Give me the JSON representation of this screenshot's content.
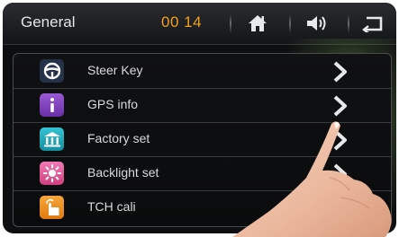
{
  "header": {
    "title": "General",
    "clock": "00 14",
    "home_icon": "home-icon",
    "volume_icon": "volume-icon",
    "back_icon": "back-icon"
  },
  "menu": {
    "items": [
      {
        "label": "Steer Key",
        "icon": "steering-wheel-icon",
        "icon_color": "#2a3550"
      },
      {
        "label": "GPS info",
        "icon": "info-icon",
        "icon_color": "#7b3fb8"
      },
      {
        "label": "Factory set",
        "icon": "factory-icon",
        "icon_color": "#1fa7b8"
      },
      {
        "label": "Backlight set",
        "icon": "backlight-icon",
        "icon_color": "#e0569e"
      },
      {
        "label": "TCH cali",
        "icon": "touch-calibration-icon",
        "icon_color": "#ef8a1a"
      }
    ]
  },
  "colors": {
    "clock": "#f0a01e",
    "background": "#0d0e10",
    "text": "#d8dadc"
  }
}
